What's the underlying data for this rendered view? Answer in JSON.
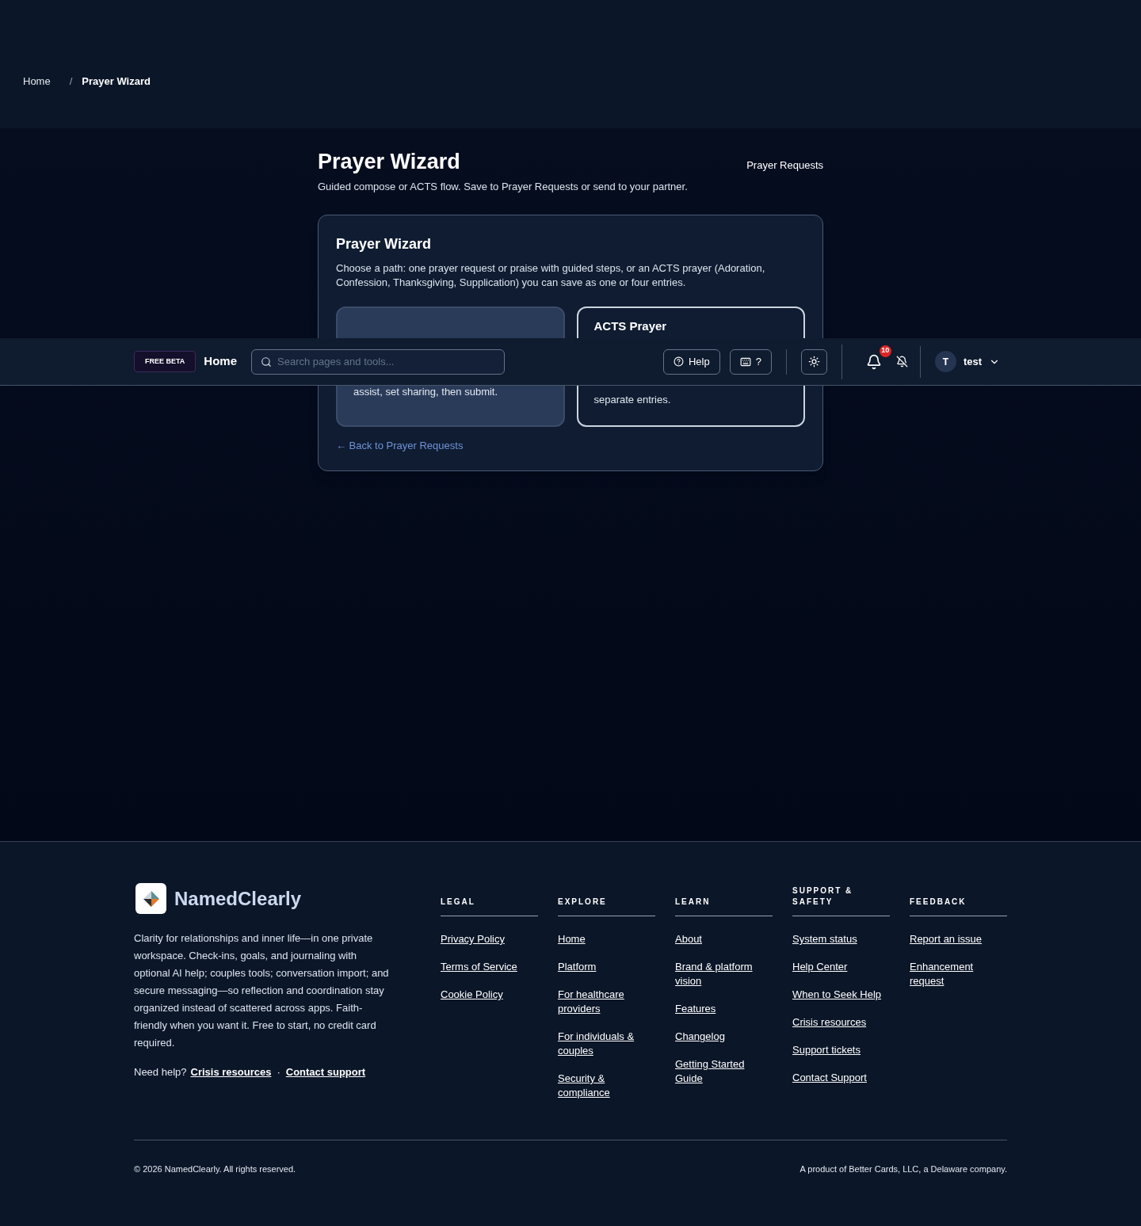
{
  "breadcrumb": {
    "separator": "/",
    "items": [
      {
        "label": "Home",
        "current": false
      },
      {
        "label": "Prayer Wizard",
        "current": true
      }
    ]
  },
  "page": {
    "title": "Prayer Wizard",
    "subtitle": "Guided compose or ACTS flow. Save to Prayer Requests or send to your partner.",
    "link": "Prayer Requests"
  },
  "card": {
    "title": "Prayer Wizard",
    "description": "Choose a path: one prayer request or praise with guided steps, or an ACTS prayer (Adoration, Confession, Thanksgiving, Supplication) you can save as one or four entries.",
    "options": [
      {
        "kind": "filled",
        "text": "assist, set sharing, then submit."
      },
      {
        "kind": "outlined",
        "title": "ACTS Prayer",
        "text": "separate entries."
      }
    ],
    "back_link": "← Back to Prayer Requests"
  },
  "navbar": {
    "badge": "FREE BETA",
    "home": "Home",
    "search": {
      "placeholder": "Search pages and tools..."
    },
    "help": "Help",
    "shortcut": "?",
    "notifications": "10",
    "avatar": "T",
    "user": "test"
  },
  "footer": {
    "brand": "NamedClearly",
    "description": "Clarity for relationships and inner life—in one private workspace. Check-ins, goals, and journaling with optional AI help; couples tools; conversation import; and secure messaging—so reflection and coordination stay organized instead of scattered across apps. Faith-friendly when you want it. Free to start, no credit card required.",
    "help_prefix": "Need help?",
    "help_links": [
      "Crisis resources",
      "Contact support"
    ],
    "separator": "·",
    "columns": [
      {
        "heading": "LEGAL",
        "links": [
          "Privacy Policy",
          "Terms of Service",
          "Cookie Policy"
        ]
      },
      {
        "heading": "EXPLORE",
        "links": [
          "Home",
          "Platform",
          "For healthcare providers",
          "For individuals & couples",
          "Security & compliance"
        ]
      },
      {
        "heading": "LEARN",
        "links": [
          "About",
          "Brand & platform vision",
          "Features",
          "Changelog",
          "Getting Started Guide"
        ]
      },
      {
        "heading": "SUPPORT & SAFETY",
        "links": [
          "System status",
          "Help Center",
          "When to Seek Help",
          "Crisis resources",
          "Support tickets",
          "Contact Support"
        ]
      },
      {
        "heading": "FEEDBACK",
        "links": [
          "Report an issue",
          "Enhancement request"
        ]
      }
    ],
    "copyright": "© 2026 NamedClearly. All rights reserved.",
    "company": "A product of Better Cards, LLC, a Delaware company."
  }
}
